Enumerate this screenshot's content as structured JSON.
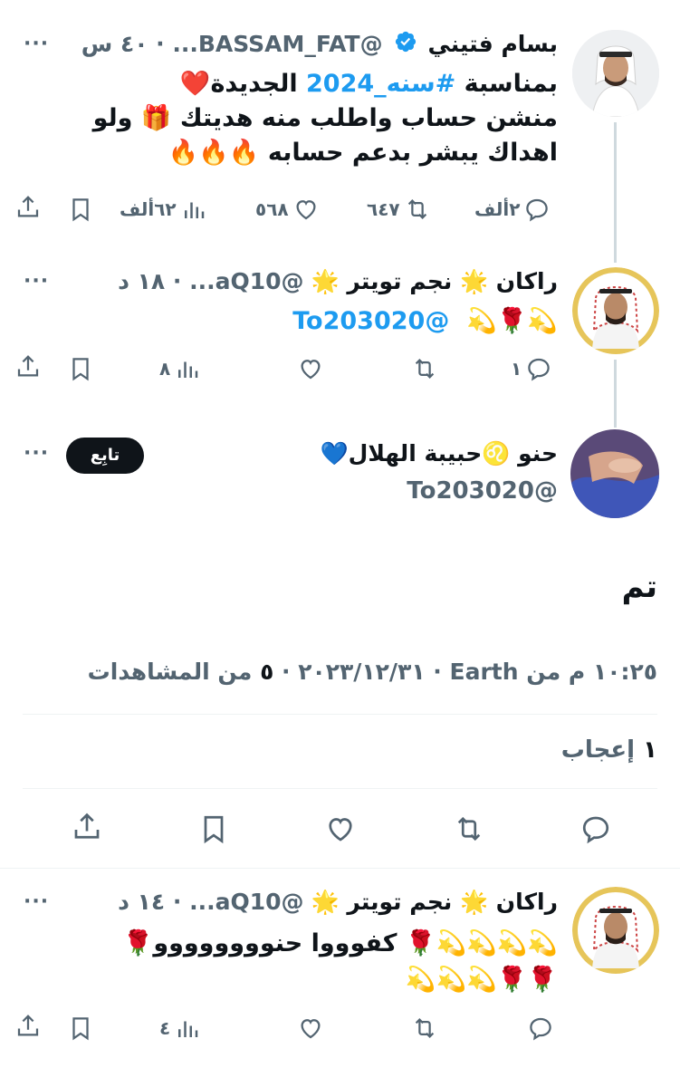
{
  "tweet1": {
    "name": "بسام فتيني",
    "handle": "@BASSAM_FAT...",
    "time": "٤٠ س",
    "line1": "بمناسبة ",
    "hashtag": "#سنه_2024",
    "line1b": " الجديدة❤️",
    "line2": "منشن حساب واطلب منه هديتك 🎁 ولو",
    "line3": "اهداك يبشر بدعم حسابه 🔥🔥🔥",
    "replies": "٢ألف",
    "retweets": "٦٤٧",
    "likes": "٥٦٨",
    "views": "٦٢ألف"
  },
  "tweet2": {
    "name": "راكان 🌟 نجم تويتر 🌟",
    "handle": "@aQ10...",
    "time": "١٨ د",
    "emojis": "💫🌹💫",
    "mention": "@To203020",
    "replies": "١",
    "views": "٨"
  },
  "main": {
    "name": "حنو ♌️حبيبة الهلال💙",
    "handle": "@To203020",
    "follow_label": "تابِع",
    "text": "تم",
    "meta_date": "١٠:٢٥ م من Earth · ٢٠٢٣/١٢/٣١",
    "meta_views_count": "٥",
    "meta_views_label": "من المشاهدات",
    "likes_count": "١",
    "likes_label": "إعجاب"
  },
  "tweet3": {
    "name": "راكان 🌟 نجم تويتر 🌟",
    "handle": "@aQ10...",
    "time": "١٤ د",
    "line1": "💫💫💫💫🌹 كفوووا  حنوووووووو🌹",
    "line2": "🌹🌹💫💫💫",
    "views": "٤"
  },
  "icons": [
    "reply-icon",
    "retweet-icon",
    "like-icon",
    "views-icon",
    "bookmark-icon",
    "share-icon",
    "verified-icon",
    "more-icon"
  ]
}
